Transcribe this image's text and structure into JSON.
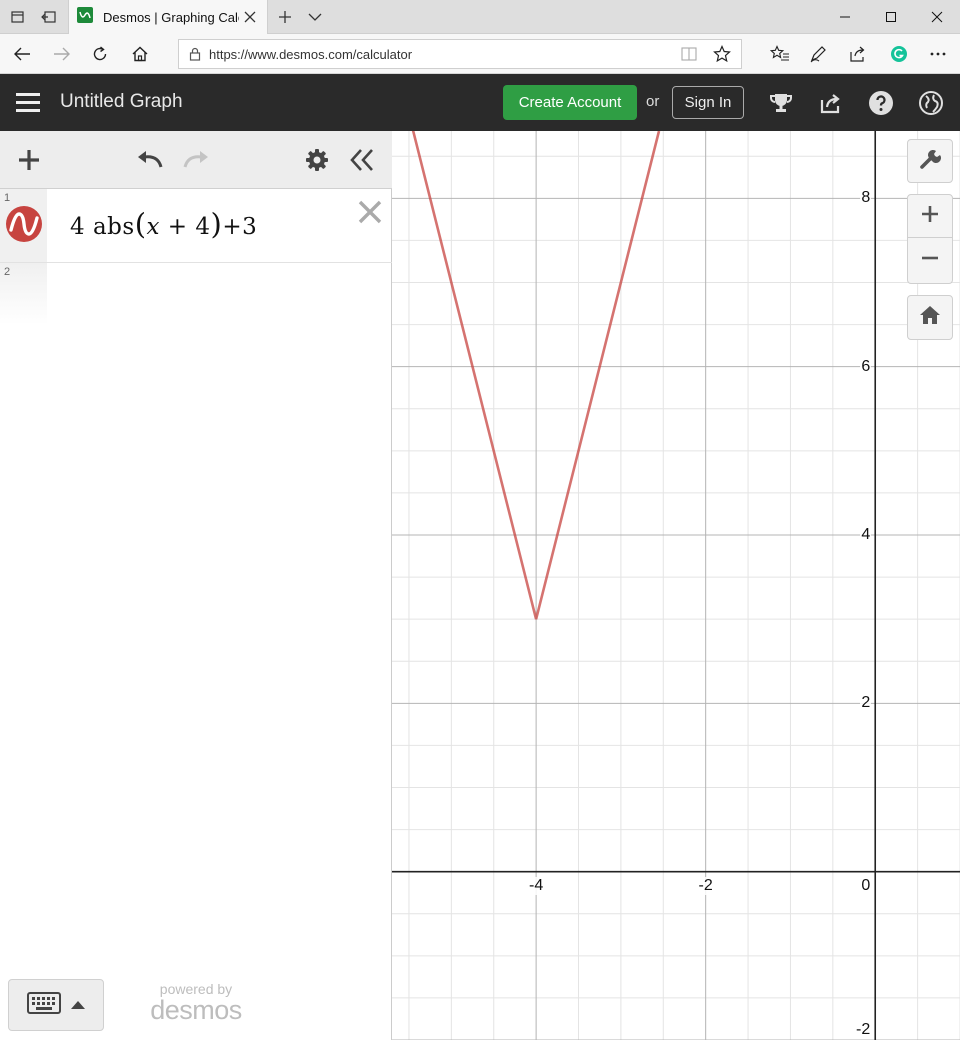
{
  "browser": {
    "tab_title": "Desmos | Graphing Calculator",
    "url": "https://www.desmos.com/calculator",
    "icons": [
      "tab-actions-icon",
      "set-aside-tabs-icon",
      "desmos-favicon",
      "close-icon",
      "new-tab-icon",
      "tab-list-icon",
      "minimize-icon",
      "maximize-icon",
      "window-close-icon",
      "back-icon",
      "forward-icon",
      "refresh-icon",
      "home-icon",
      "lock-icon",
      "reading-view-icon",
      "favorite-star-icon",
      "favorites-list-icon",
      "pen-icon",
      "share-icon",
      "grammarly-icon",
      "more-icon"
    ]
  },
  "header": {
    "title": "Untitled Graph",
    "create_account": "Create Account",
    "or": "or",
    "sign_in": "Sign In"
  },
  "expressions": [
    {
      "index": "1",
      "parts": [
        "4 abs",
        "(",
        "x",
        " + 4",
        ")",
        "+3"
      ],
      "color": "#c74440"
    },
    {
      "index": "2"
    }
  ],
  "powered_by": {
    "line1": "powered by",
    "line2": "desmos"
  },
  "graph": {
    "x_ticks": [
      {
        "value": -4,
        "label": "-4"
      },
      {
        "value": -2,
        "label": "-2"
      },
      {
        "value": 0,
        "label": "0"
      }
    ],
    "y_ticks": [
      {
        "value": 8,
        "label": "8"
      },
      {
        "value": 6,
        "label": "6"
      },
      {
        "value": 4,
        "label": "4"
      },
      {
        "value": 2,
        "label": "2"
      },
      {
        "value": -2,
        "label": "-2"
      }
    ],
    "curve_color": "#c74440",
    "accent_green": "#2f9e44",
    "header_bg": "#2a2a2a"
  },
  "chart_data": {
    "type": "line",
    "xlim": [
      -5.7,
      1.0
    ],
    "ylim": [
      -2.0,
      8.8
    ],
    "grid": true,
    "series": [
      {
        "expression": "4 abs(x + 4)+3",
        "x": [
          -5.7,
          -4,
          -2.55
        ],
        "y": [
          9.8,
          3,
          8.8
        ]
      }
    ]
  }
}
